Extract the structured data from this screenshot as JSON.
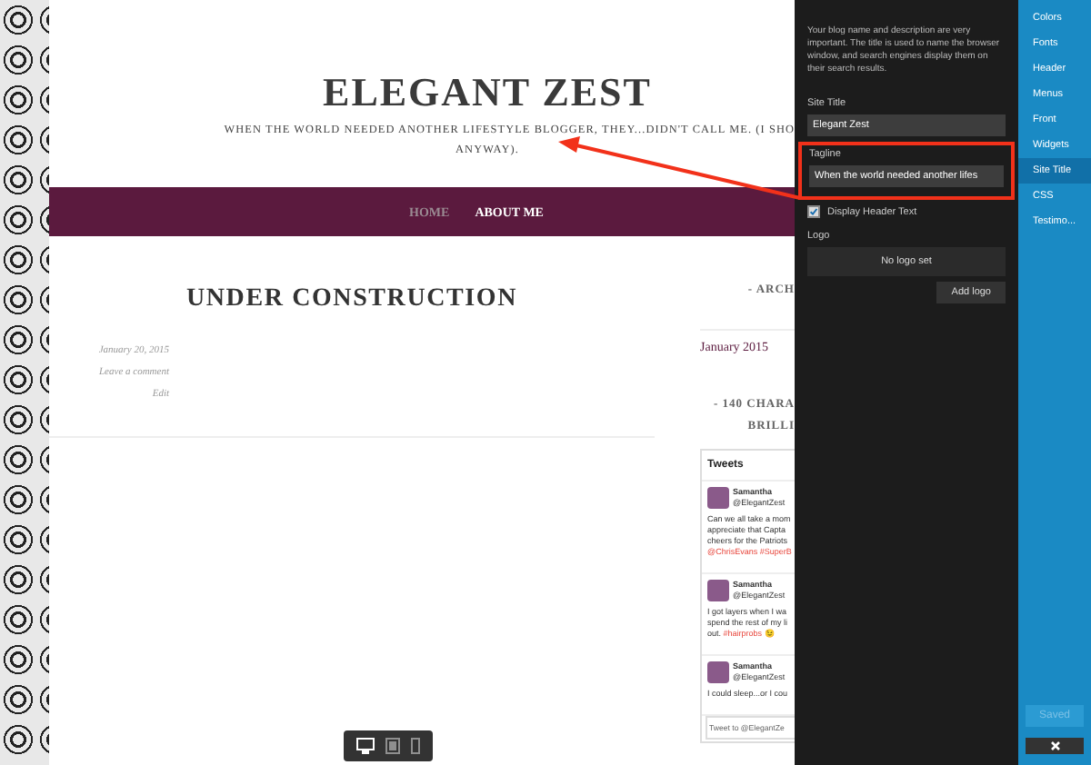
{
  "blog": {
    "title": "ELEGANT ZEST",
    "tagline_lines": [
      "WHEN THE WORLD NEEDED ANOTHER LIFESTYLE BLOGGER, THEY...DIDN'T CALL ME. (I SHO",
      "ANYWAY)."
    ],
    "nav": [
      {
        "label": "HOME",
        "selected": false
      },
      {
        "label": "ABOUT ME",
        "selected": true
      }
    ],
    "post": {
      "title": "UNDER CONSTRUCTION",
      "meta": [
        "January 20, 2015",
        "Leave a comment",
        "Edit"
      ]
    },
    "sidebar": {
      "archive_heading": "- ARCH",
      "archive_items": [
        "January 2015"
      ],
      "tweets_heading_lines": [
        "- 140 CHARA",
        "BRILLI"
      ],
      "tweets": {
        "title": "Tweets",
        "items": [
          {
            "name": "Samantha",
            "handle": "@ElegantZest",
            "lines": [
              [
                {
                  "text": "Can we all take a mom",
                  "link": false
                }
              ],
              [
                {
                  "text": "appreciate that Capta",
                  "link": false
                }
              ],
              [
                {
                  "text": "cheers for the Patriots",
                  "link": false
                }
              ],
              [
                {
                  "text": "@ChrisEvans #SuperB",
                  "link": true
                }
              ]
            ]
          },
          {
            "name": "Samantha",
            "handle": "@ElegantZest",
            "lines": [
              [
                {
                  "text": "I got layers when I wa",
                  "link": false
                }
              ],
              [
                {
                  "text": "spend the rest of my li",
                  "link": false
                }
              ],
              [
                {
                  "text": "out. ",
                  "link": false
                },
                {
                  "text": "#hairprobs 😉",
                  "link": true
                }
              ]
            ]
          },
          {
            "name": "Samantha",
            "handle": "@ElegantZest",
            "lines": [
              [
                {
                  "text": "I could sleep...or I cou",
                  "link": false
                }
              ]
            ]
          }
        ],
        "compose": "Tweet to @ElegantZe"
      }
    }
  },
  "preview_devices": [
    {
      "kind": "desktop",
      "selected": true
    },
    {
      "kind": "tablet",
      "selected": false
    },
    {
      "kind": "phone",
      "selected": false
    }
  ],
  "customizer": {
    "description": "Your blog name and description are very important. The title is used to name the browser window, and search engines display them on their search results.",
    "site_title": {
      "label": "Site Title",
      "value": "Elegant Zest"
    },
    "tagline": {
      "label": "Tagline",
      "value": "When the world needed another lifes",
      "highlighted": true
    },
    "display_header_text": {
      "label": "Display Header Text",
      "checked": true
    },
    "logo": {
      "label": "Logo",
      "status": "No logo set",
      "button": "Add logo"
    }
  },
  "menu": [
    {
      "label": "Colors",
      "selected": false
    },
    {
      "label": "Fonts",
      "selected": false
    },
    {
      "label": "Header",
      "selected": false
    },
    {
      "label": "Menus",
      "selected": false
    },
    {
      "label": "Front",
      "selected": false
    },
    {
      "label": "Widgets",
      "selected": false
    },
    {
      "label": "Site Title",
      "selected": true
    },
    {
      "label": "CSS",
      "selected": false
    },
    {
      "label": "Testimo...",
      "selected": false
    }
  ],
  "saved": {
    "label": "Saved",
    "disabled": true
  }
}
